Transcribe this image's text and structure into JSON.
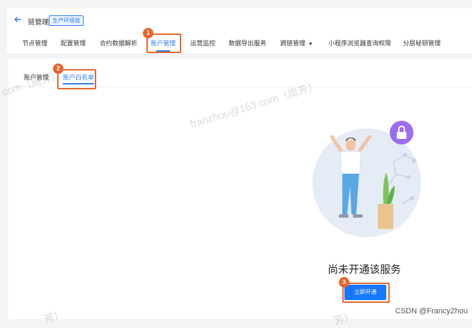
{
  "header": {
    "back_icon": "arrow-left-icon",
    "title": "链管理",
    "env_badge": "生产环境链"
  },
  "nav_tabs": [
    {
      "label": "节点管理",
      "active": false
    },
    {
      "label": "配置管理",
      "active": false
    },
    {
      "label": "合约数据解析",
      "active": false
    },
    {
      "label": "账户管理",
      "active": true
    },
    {
      "label": "运营监控",
      "active": false
    },
    {
      "label": "数据导出服务",
      "active": false
    },
    {
      "label": "跨链管理",
      "active": false,
      "has_dropdown": true
    },
    {
      "label": "小程序浏览器查询权限",
      "active": false
    },
    {
      "label": "分层秘钥管理",
      "active": false
    }
  ],
  "sub_tabs": [
    {
      "label": "账户管理",
      "active": false
    },
    {
      "label": "账户白名单",
      "active": true
    }
  ],
  "markers": [
    "1",
    "2",
    "3"
  ],
  "empty_state": {
    "message": "尚未开通该服务",
    "button_label": "立即开通",
    "illustration_icon": "lock-icon"
  },
  "watermark": {
    "text_main": "franzhou@163.com（周芳）",
    "text_left": "com（周芳）",
    "text_bottom_left": "芳）",
    "text_bottom_mid": "芳）"
  },
  "footer": {
    "credit": "CSDN @FrancyZhou"
  },
  "colors": {
    "accent": "#1677ff",
    "highlight": "#e8652c",
    "lock_badge": "#9b6cf0"
  }
}
